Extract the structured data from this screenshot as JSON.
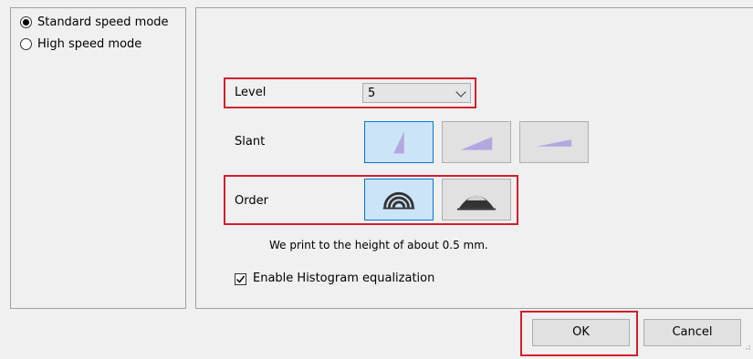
{
  "mode_panel": {
    "options": [
      {
        "label": "Standard speed mode",
        "checked": true
      },
      {
        "label": "High speed mode",
        "checked": false
      }
    ]
  },
  "settings": {
    "level_label": "Level",
    "level_value": "5",
    "slant_label": "Slant",
    "order_label": "Order",
    "height_note": "We print to the height of about 0.5 mm.",
    "histogram_label": "Enable Histogram equalization",
    "histogram_checked": true
  },
  "footer": {
    "ok_label": "OK",
    "cancel_label": "Cancel"
  },
  "icons": {
    "slant": [
      "slant-steep-icon",
      "slant-medium-icon",
      "slant-shallow-icon"
    ],
    "order": [
      "order-concentric-arch-icon",
      "order-mound-icon"
    ]
  },
  "colors": {
    "highlight": "#d11f2b",
    "selected_button": "#cce4f7",
    "selected_border": "#0078d7"
  }
}
